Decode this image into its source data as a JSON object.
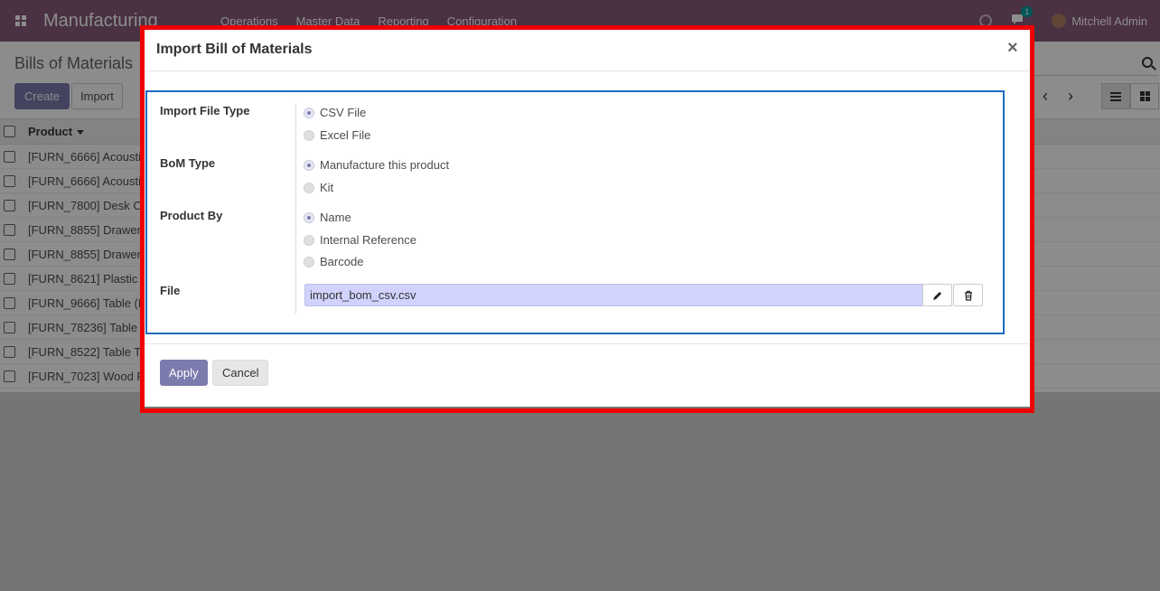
{
  "navbar": {
    "app_title": "Manufacturing",
    "menu": [
      "Operations",
      "Master Data",
      "Reporting",
      "Configuration"
    ],
    "chat_count": "1",
    "user_name": "Mitchell Admin"
  },
  "control_panel": {
    "breadcrumb": "Bills of Materials",
    "create_label": "Create",
    "import_label": "Import"
  },
  "list": {
    "column_product": "Product",
    "rows": [
      "[FURN_6666] Acousti",
      "[FURN_6666] Acousti",
      "[FURN_7800] Desk C",
      "[FURN_8855] Drawer",
      "[FURN_8855] Drawer",
      "[FURN_8621] Plastic",
      "[FURN_9666] Table (M",
      "[FURN_78236] Table",
      "[FURN_8522] Table T",
      "[FURN_7023] Wood P"
    ]
  },
  "dialog": {
    "title": "Import Bill of Materials",
    "close_symbol": "×",
    "fields": {
      "file_type": {
        "label": "Import File Type",
        "options": [
          "CSV File",
          "Excel File"
        ],
        "selected": "CSV File"
      },
      "bom_type": {
        "label": "BoM Type",
        "options": [
          "Manufacture this product",
          "Kit"
        ],
        "selected": "Manufacture this product"
      },
      "product_by": {
        "label": "Product By",
        "options": [
          "Name",
          "Internal Reference",
          "Barcode"
        ],
        "selected": "Name"
      },
      "file": {
        "label": "File",
        "value": "import_bom_csv.csv"
      }
    },
    "apply_label": "Apply",
    "cancel_label": "Cancel"
  },
  "icons": {
    "apps": "apps-grid-icon",
    "clock": "clock-icon",
    "chat": "chat-icon",
    "search": "search-icon",
    "prev": "chevron-left-icon",
    "next": "chevron-right-icon",
    "list_view": "list-view-icon",
    "kanban_view": "kanban-view-icon",
    "edit": "pencil-icon",
    "delete": "trash-icon"
  },
  "colors": {
    "navbar": "#875a7b",
    "primary": "#7c7bad",
    "highlight": "#ee0000",
    "focus": "#1d6cbf",
    "file_field": "#d2d2ff"
  }
}
